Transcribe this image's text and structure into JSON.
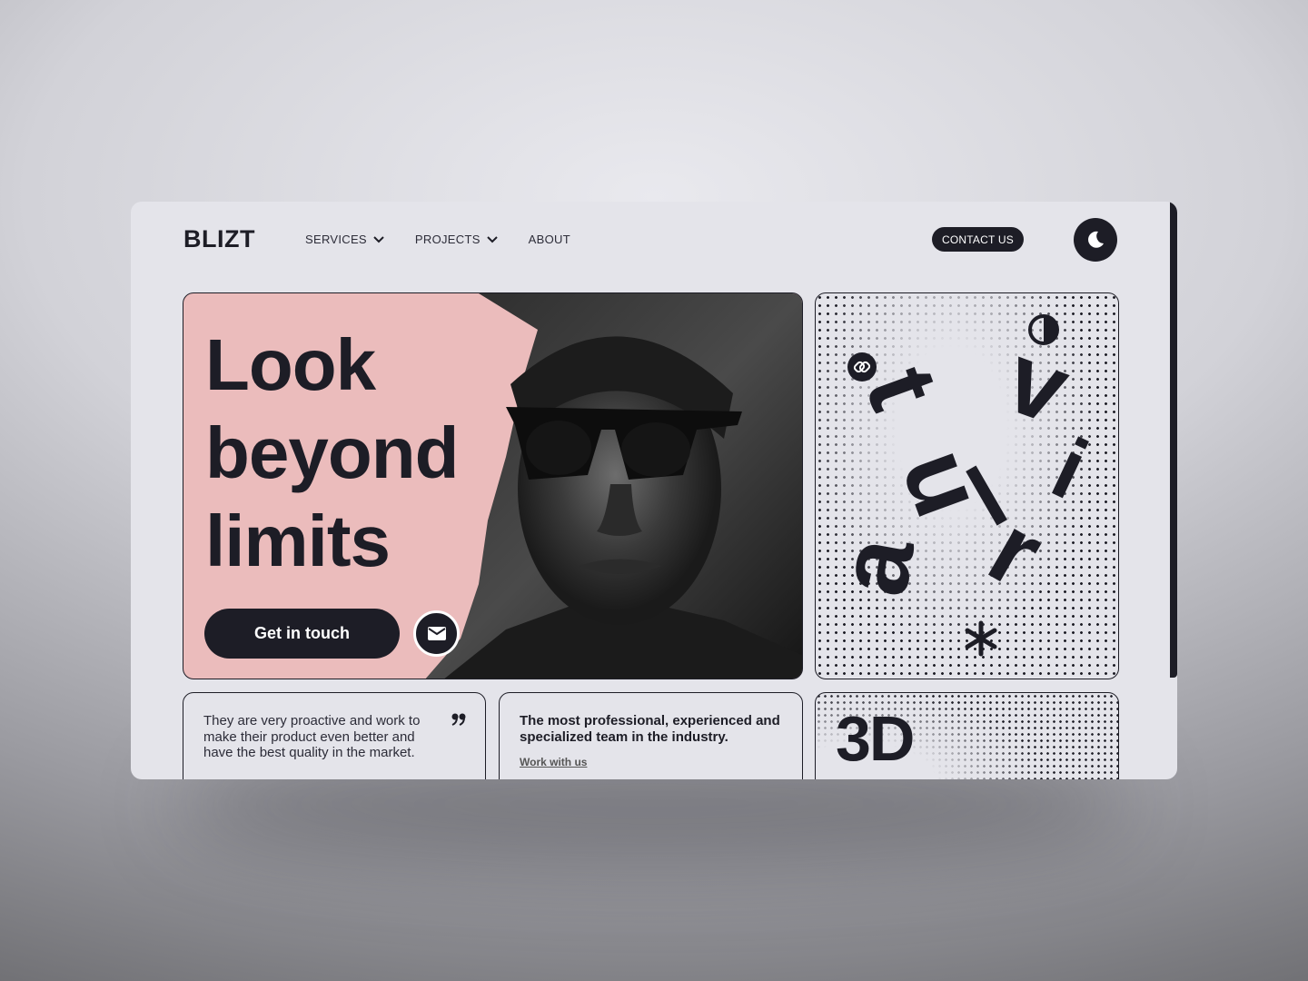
{
  "brand": {
    "logo": "BLIZT"
  },
  "nav": {
    "items": [
      {
        "label": "SERVICES",
        "has_dropdown": true
      },
      {
        "label": "PROJECTS",
        "has_dropdown": true
      },
      {
        "label": "ABOUT",
        "has_dropdown": false
      }
    ],
    "contact_label": "CONTACT US",
    "theme_toggle_icon": "moon-icon"
  },
  "hero": {
    "title_lines": [
      "Look",
      "beyond",
      "limits"
    ],
    "cta_label": "Get in touch",
    "mail_icon": "envelope-icon",
    "image": "portrait of man in hood with sunglasses",
    "background_color": "#ebbcbc"
  },
  "feature_card": {
    "word_letters": [
      "v",
      "i",
      "r",
      "t",
      "u",
      "a",
      "l"
    ],
    "icons": [
      "contrast-icon",
      "link-icon",
      "snowflake-icon"
    ]
  },
  "cards": {
    "testimonial": {
      "text": "They are very proactive and work to make their product even better and have the best quality in the market.",
      "icon": "quote-icon"
    },
    "team": {
      "title": "The most professional, experienced and specialized team in the industry.",
      "link_label": "Work with us"
    },
    "threed": {
      "label": "3D"
    }
  },
  "colors": {
    "dark": "#1d1d26",
    "surface": "#e4e4ea",
    "accent_pink": "#ebbcbc"
  }
}
